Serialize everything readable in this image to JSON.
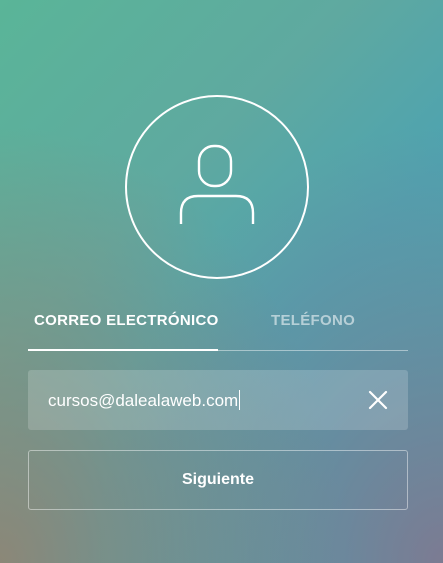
{
  "avatar": {
    "icon": "user-icon"
  },
  "tabs": [
    {
      "label": "CORREO ELECTRÓNICO",
      "active": true
    },
    {
      "label": "TELÉFONO",
      "active": false
    }
  ],
  "email_input": {
    "value": "cursos@dalealaweb.com",
    "clear_icon": "close-icon"
  },
  "next_button": {
    "label": "Siguiente"
  },
  "colors": {
    "text": "#ffffff",
    "inactive_tab": "#ffffff8c",
    "gradient_top_left": "#5ab598",
    "gradient_top_right": "#3ea8b6",
    "gradient_bottom_left": "#96826e",
    "gradient_bottom_right": "#87738c"
  }
}
